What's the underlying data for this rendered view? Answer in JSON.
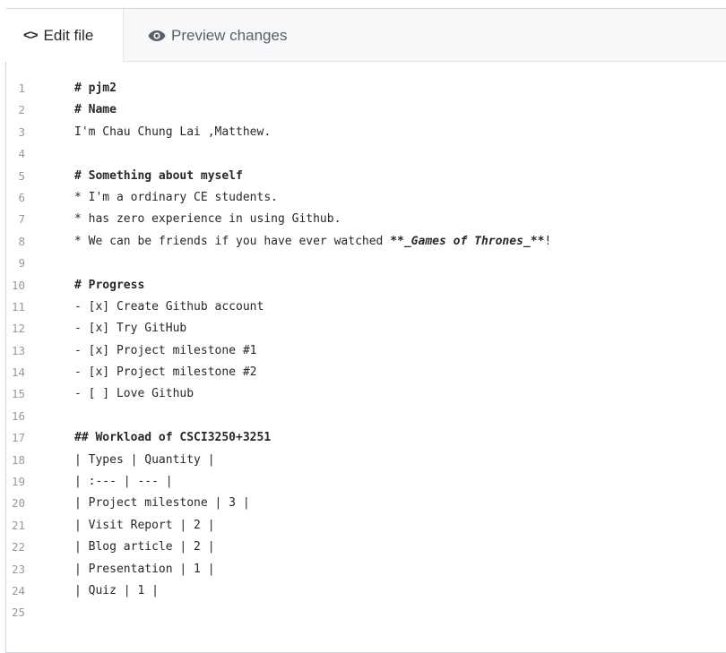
{
  "tabs": {
    "edit": {
      "icon": "code-icon",
      "glyph": "<>",
      "label": "Edit file"
    },
    "preview": {
      "icon": "eye-icon",
      "label": "Preview changes"
    }
  },
  "editor": {
    "lines": [
      {
        "num": "1",
        "segments": [
          {
            "text": "# pjm2",
            "style": "bold"
          }
        ]
      },
      {
        "num": "2",
        "segments": [
          {
            "text": "# Name",
            "style": "bold"
          }
        ]
      },
      {
        "num": "3",
        "segments": [
          {
            "text": "I'm Chau Chung Lai ,Matthew.",
            "style": "normal"
          }
        ]
      },
      {
        "num": "4",
        "segments": []
      },
      {
        "num": "5",
        "segments": [
          {
            "text": "# Something about myself",
            "style": "bold"
          }
        ]
      },
      {
        "num": "6",
        "segments": [
          {
            "text": "* I'm a ordinary CE students.",
            "style": "normal"
          }
        ]
      },
      {
        "num": "7",
        "segments": [
          {
            "text": "* has zero experience in using Github.",
            "style": "normal"
          }
        ]
      },
      {
        "num": "8",
        "segments": [
          {
            "text": "* We can be friends if you have ever watched ",
            "style": "normal"
          },
          {
            "text": "**",
            "style": "bold"
          },
          {
            "text": "_Games of Thrones_",
            "style": "bolditalic"
          },
          {
            "text": "**",
            "style": "bold"
          },
          {
            "text": "!",
            "style": "normal"
          }
        ]
      },
      {
        "num": "9",
        "segments": []
      },
      {
        "num": "10",
        "segments": [
          {
            "text": "# Progress",
            "style": "bold"
          }
        ]
      },
      {
        "num": "11",
        "segments": [
          {
            "text": "- [x] Create Github account",
            "style": "normal"
          }
        ]
      },
      {
        "num": "12",
        "segments": [
          {
            "text": "- [x] Try GitHub",
            "style": "normal"
          }
        ]
      },
      {
        "num": "13",
        "segments": [
          {
            "text": "- [x] Project milestone #1",
            "style": "normal"
          }
        ]
      },
      {
        "num": "14",
        "segments": [
          {
            "text": "- [x] Project milestone #2",
            "style": "normal"
          }
        ]
      },
      {
        "num": "15",
        "segments": [
          {
            "text": "- [ ] Love Github",
            "style": "normal"
          }
        ]
      },
      {
        "num": "16",
        "segments": []
      },
      {
        "num": "17",
        "segments": [
          {
            "text": "## Workload of CSCI3250+3251",
            "style": "bold"
          }
        ]
      },
      {
        "num": "18",
        "segments": [
          {
            "text": "| Types | Quantity |",
            "style": "normal"
          }
        ]
      },
      {
        "num": "19",
        "segments": [
          {
            "text": "| :--- | --- |",
            "style": "normal"
          }
        ]
      },
      {
        "num": "20",
        "segments": [
          {
            "text": "| Project milestone | 3 |",
            "style": "normal"
          }
        ]
      },
      {
        "num": "21",
        "segments": [
          {
            "text": "| Visit Report | 2 |",
            "style": "normal"
          }
        ]
      },
      {
        "num": "22",
        "segments": [
          {
            "text": "| Blog article | 2 |",
            "style": "normal"
          }
        ]
      },
      {
        "num": "23",
        "segments": [
          {
            "text": "| Presentation | 1 |",
            "style": "normal"
          }
        ]
      },
      {
        "num": "24",
        "segments": [
          {
            "text": "| Quiz | 1 |",
            "style": "normal"
          }
        ]
      },
      {
        "num": "25",
        "segments": []
      }
    ]
  }
}
